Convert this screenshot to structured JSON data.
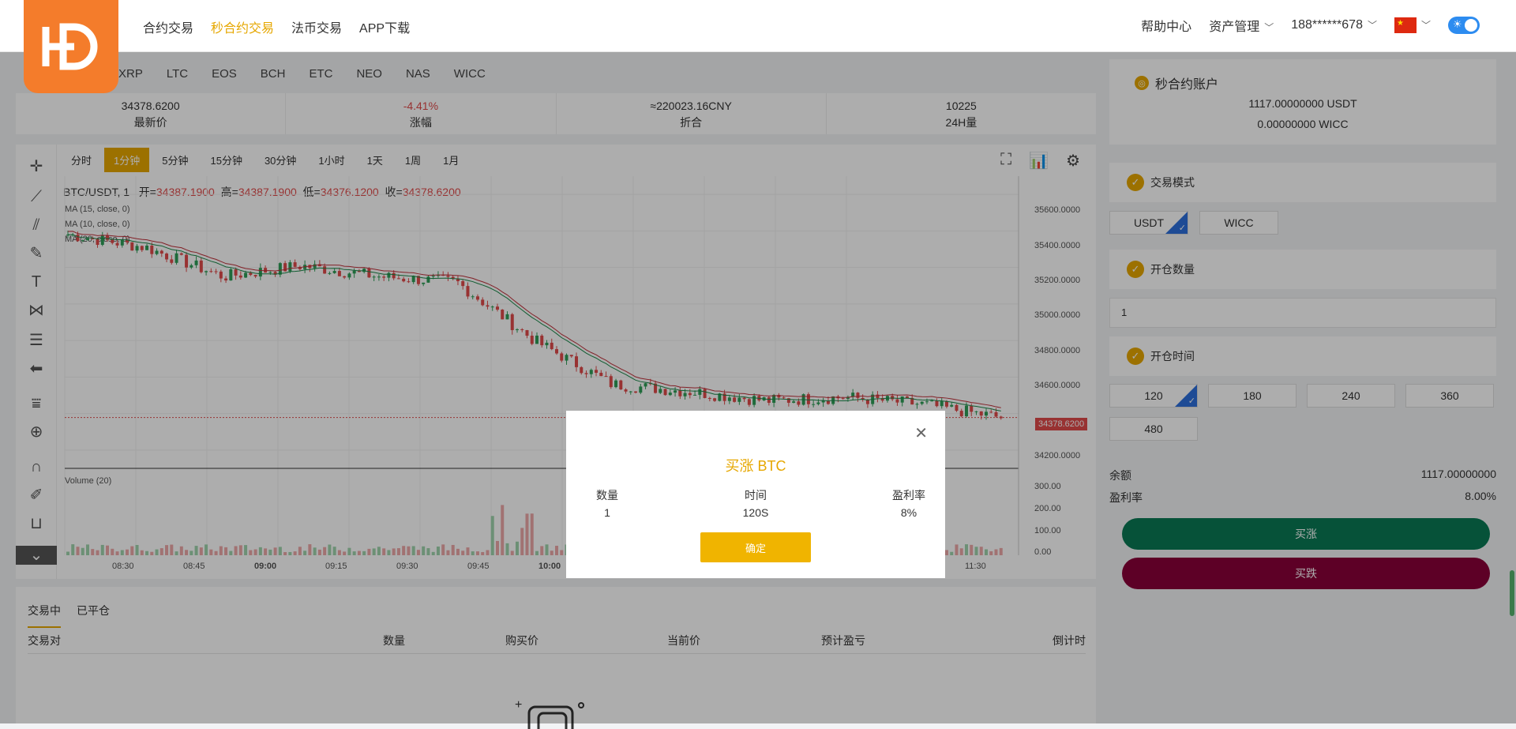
{
  "nav": {
    "items": [
      "合约交易",
      "秒合约交易",
      "法币交易",
      "APP下载"
    ],
    "active_index": 1,
    "help": "帮助中心",
    "assets": "资产管理",
    "user": "188******678"
  },
  "coins": [
    "XRP",
    "LTC",
    "EOS",
    "BCH",
    "ETC",
    "NEO",
    "NAS",
    "WICC"
  ],
  "stats": [
    {
      "value": "34378.6200",
      "label": "最新价"
    },
    {
      "value": "-4.41%",
      "label": "涨幅"
    },
    {
      "value": "≈220023.16CNY",
      "label": "折合"
    },
    {
      "value": "10225",
      "label": "24H量"
    }
  ],
  "intervals": [
    "分时",
    "1分钟",
    "5分钟",
    "15分钟",
    "30分钟",
    "1小时",
    "1天",
    "1周",
    "1月"
  ],
  "active_interval": 1,
  "chart": {
    "symbol": "BTC/USDT, 1",
    "open_label": "开=",
    "open": "34387.1900",
    "high_label": "高=",
    "high": "34387.1900",
    "low_label": "低=",
    "low": "34376.1200",
    "close_label": "收=",
    "close": "34378.6200",
    "ma_labels": [
      "MA (15, close, 0)",
      "MA (10, close, 0)",
      "MA (20, close, 0)"
    ],
    "volume_label": "Volume (20)",
    "price_ticks": [
      "35600.0000",
      "35400.0000",
      "35200.0000",
      "35000.0000",
      "34800.0000",
      "34600.0000",
      "34400.0000",
      "34200.0000"
    ],
    "vol_ticks": [
      "300.00",
      "200.00",
      "100.00",
      "0.00"
    ],
    "current_price_tag": "34378.6200",
    "time_ticks": [
      "08:30",
      "08:45",
      "09:00",
      "09:15",
      "09:30",
      "09:45",
      "10:00",
      "11:30"
    ]
  },
  "chart_data": {
    "type": "candlestick",
    "title": "BTC/USDT, 1",
    "ylabel": "",
    "ylim": [
      34100,
      35700
    ],
    "series_trend": [
      {
        "t": "08:30",
        "price": 35380
      },
      {
        "t": "08:45",
        "price": 35310
      },
      {
        "t": "09:00",
        "price": 35150
      },
      {
        "t": "09:15",
        "price": 35210
      },
      {
        "t": "09:30",
        "price": 35150
      },
      {
        "t": "09:45",
        "price": 35120
      },
      {
        "t": "10:00",
        "price": 34800
      },
      {
        "t": "10:15",
        "price": 34560
      },
      {
        "t": "10:30",
        "price": 34520
      },
      {
        "t": "10:45",
        "price": 34470
      },
      {
        "t": "11:00",
        "price": 34490
      },
      {
        "t": "11:15",
        "price": 34450
      },
      {
        "t": "11:30",
        "price": 34378.62
      }
    ]
  },
  "orders": {
    "tabs": [
      "交易中",
      "已平仓"
    ],
    "headers": [
      "交易对",
      "数量",
      "购买价",
      "当前价",
      "预计盈亏",
      "倒计时"
    ]
  },
  "panel": {
    "account_title": "秒合约账户",
    "usdt_balance": "1117.00000000 USDT",
    "wicc_balance": "0.00000000 WICC",
    "mode_title": "交易模式",
    "modes": [
      "USDT",
      "WICC"
    ],
    "qty_title": "开仓数量",
    "qty_value": "1",
    "time_title": "开仓时间",
    "times": [
      "120",
      "180",
      "240",
      "360",
      "480"
    ],
    "balance_label": "余额",
    "balance_value": "1117.00000000",
    "rate_label": "盈利率",
    "rate_value": "8.00%",
    "buy_up": "买涨",
    "buy_down": "买跌"
  },
  "modal": {
    "title": "买涨 BTC",
    "cols": [
      {
        "label": "数量",
        "value": "1"
      },
      {
        "label": "时间",
        "value": "120S"
      },
      {
        "label": "盈利率",
        "value": "8%"
      }
    ],
    "confirm": "确定"
  },
  "colors": {
    "accent": "#e6a700",
    "up": "#0a7a55",
    "down": "#8a0038",
    "red": "#e04a4a",
    "green": "#2e9e57"
  }
}
